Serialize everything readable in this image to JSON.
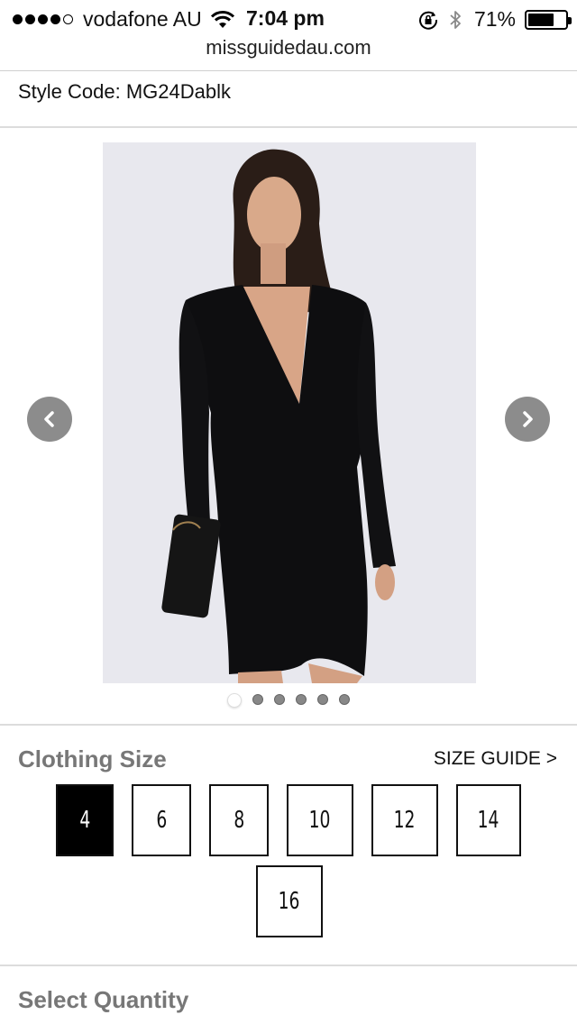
{
  "status_bar": {
    "carrier": "vodafone AU",
    "time": "7:04 pm",
    "battery_percent": "71%",
    "battery_level": 0.71,
    "signal_bars": 4
  },
  "browser": {
    "url": "missguidedau.com"
  },
  "product": {
    "style_code": "Style Code: MG24Dablk",
    "image_pager": {
      "count": 6,
      "active_index": 0
    }
  },
  "size": {
    "title": "Clothing Size",
    "size_guide": "SIZE GUIDE >",
    "options": [
      "4",
      "6",
      "8",
      "10",
      "12",
      "14",
      "16"
    ],
    "selected": "4"
  },
  "quantity": {
    "title": "Select Quantity"
  },
  "icons": {
    "wifi": "wifi-icon",
    "rotation_lock": "rotation-lock-icon",
    "bluetooth": "bluetooth-icon",
    "battery": "battery-icon",
    "prev": "chevron-left-icon",
    "next": "chevron-right-icon"
  }
}
